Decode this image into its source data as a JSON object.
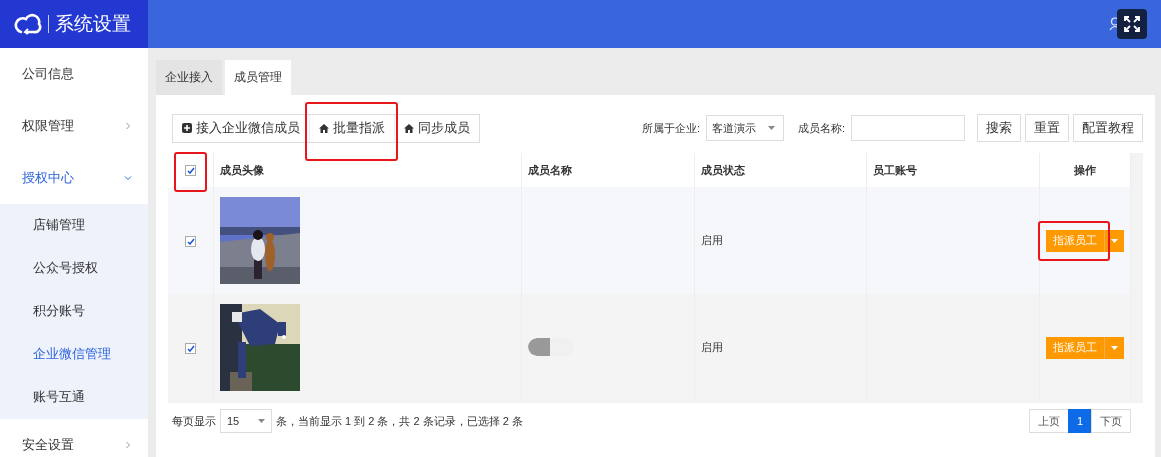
{
  "header": {
    "title": "系统设置"
  },
  "sidebar": {
    "items": [
      {
        "label": "公司信息",
        "selected": false
      },
      {
        "label": "权限管理",
        "expanded": false
      },
      {
        "label": "授权中心",
        "expanded": true,
        "children": [
          {
            "label": "店铺管理",
            "selected": false
          },
          {
            "label": "公众号授权",
            "selected": false
          },
          {
            "label": "积分账号",
            "selected": false
          },
          {
            "label": "企业微信管理",
            "selected": true
          },
          {
            "label": "账号互通",
            "selected": false
          }
        ]
      },
      {
        "label": "安全设置",
        "expanded": false
      }
    ]
  },
  "tabs": [
    {
      "label": "企业接入",
      "selected": false
    },
    {
      "label": "成员管理",
      "selected": true
    }
  ],
  "toolbar": {
    "buttons": [
      {
        "label": "接入企业微信成员",
        "kind": "plus",
        "highlighted": false
      },
      {
        "label": "批量指派",
        "kind": "home",
        "highlighted": true
      },
      {
        "label": "同步成员",
        "kind": "home",
        "highlighted": false
      }
    ],
    "filters": {
      "company_label": "所属于企业:",
      "company_value": "客道演示",
      "name_label": "成员名称:"
    },
    "actions": [
      "搜索",
      "重置",
      "配置教程"
    ]
  },
  "table": {
    "select_all": {
      "checked": true,
      "highlighted": true
    },
    "columns": [
      "成员头像",
      "成员名称",
      "成员状态",
      "员工账号",
      "操作"
    ],
    "rows": [
      {
        "checked": true,
        "status": "启用",
        "action": "指派员工",
        "highlighted": true,
        "toggle": null
      },
      {
        "checked": true,
        "status": "启用",
        "action": "指派员工",
        "highlighted": false,
        "toggle": {
          "on": false
        }
      }
    ]
  },
  "footer": {
    "per_page_label": "每页显示",
    "per_page": "15",
    "summary": "条，当前显示 1 到 2 条，共 2 条记录，已选择 2 条",
    "pager": [
      {
        "label": "上页",
        "selected": false
      },
      {
        "label": "1",
        "selected": true
      },
      {
        "label": "下页",
        "selected": false
      }
    ]
  }
}
